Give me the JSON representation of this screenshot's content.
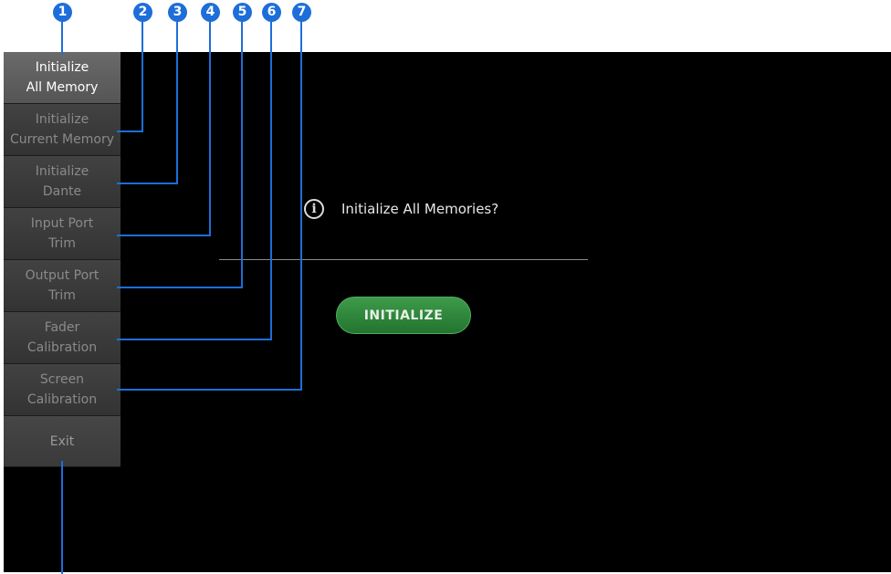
{
  "menu": {
    "items": [
      {
        "label_line1": "Initialize",
        "label_line2": "All Memory"
      },
      {
        "label_line1": "Initialize",
        "label_line2": "Current Memory"
      },
      {
        "label_line1": "Initialize",
        "label_line2": "Dante"
      },
      {
        "label_line1": "Input Port",
        "label_line2": "Trim"
      },
      {
        "label_line1": "Output Port",
        "label_line2": "Trim"
      },
      {
        "label_line1": "Fader",
        "label_line2": "Calibration"
      },
      {
        "label_line1": "Screen",
        "label_line2": "Calibration"
      }
    ],
    "exit_label": "Exit"
  },
  "dialog": {
    "message": "Initialize All Memories?",
    "info_icon": "info-icon",
    "initialize_label": "INITIALIZE"
  },
  "callouts": [
    "1",
    "2",
    "3",
    "4",
    "5",
    "6",
    "7"
  ],
  "colors": {
    "callout": "#1d6ed8",
    "accent_green": "#2e8a3b",
    "background": "#000000"
  }
}
